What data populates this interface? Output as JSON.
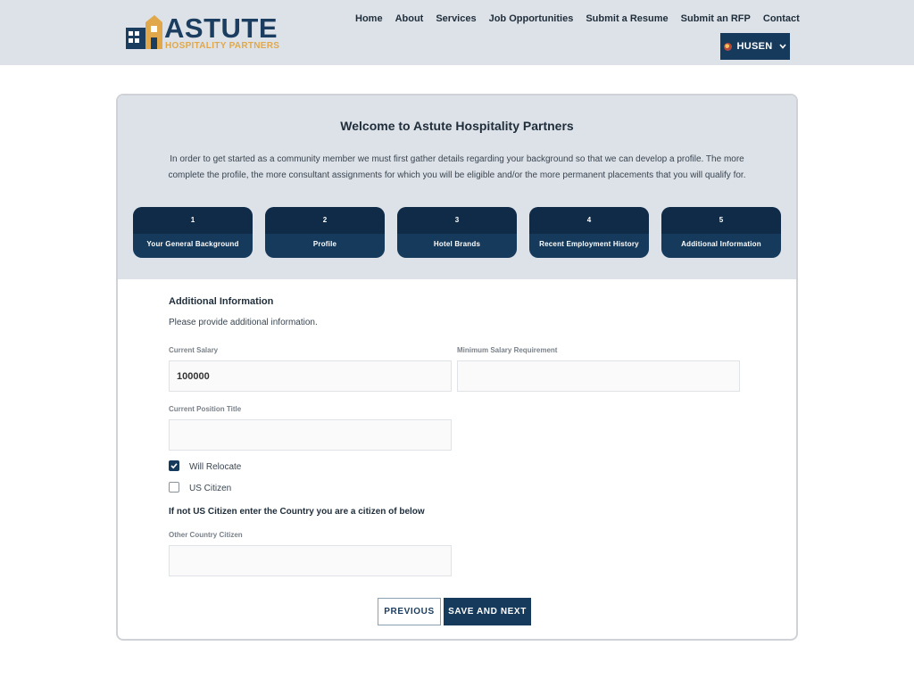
{
  "brand": {
    "name": "ASTUTE",
    "tagline": "HOSPITALITY PARTNERS",
    "color_primary": "#1b3d5f",
    "color_accent": "#e0a84a"
  },
  "nav": {
    "items": [
      "Home",
      "About",
      "Services",
      "Job Opportunities",
      "Submit a Resume",
      "Submit an RFP",
      "Contact"
    ]
  },
  "user": {
    "name": "HUSEN",
    "icon": "chevron-down-icon"
  },
  "welcome": {
    "title": "Welcome to Astute Hospitality Partners",
    "intro": "In order to get started as a community member we must first gather details regarding your background so that we can develop a profile. The more complete the profile, the more consultant assignments for which you will be eligible and/or the more permanent placements that you will qualify for."
  },
  "steps": [
    {
      "number": "1",
      "label": "Your General Background"
    },
    {
      "number": "2",
      "label": "Profile"
    },
    {
      "number": "3",
      "label": "Hotel Brands"
    },
    {
      "number": "4",
      "label": "Recent Employment History"
    },
    {
      "number": "5",
      "label": "Additional Information"
    }
  ],
  "form": {
    "section_title": "Additional Information",
    "section_desc": "Please provide additional information.",
    "current_salary": {
      "label": "Current Salary",
      "value": "100000"
    },
    "min_salary": {
      "label": "Minimum Salary Requirement",
      "value": ""
    },
    "position_title": {
      "label": "Current Position Title",
      "value": ""
    },
    "will_relocate": {
      "label": "Will Relocate",
      "checked": true
    },
    "us_citizen": {
      "label": "US Citizen",
      "checked": false
    },
    "note": "If not US Citizen enter the Country you are a citizen of below",
    "other_country": {
      "label": "Other Country Citizen",
      "value": ""
    },
    "previous_label": "PREVIOUS",
    "next_label": "SAVE AND NEXT"
  }
}
